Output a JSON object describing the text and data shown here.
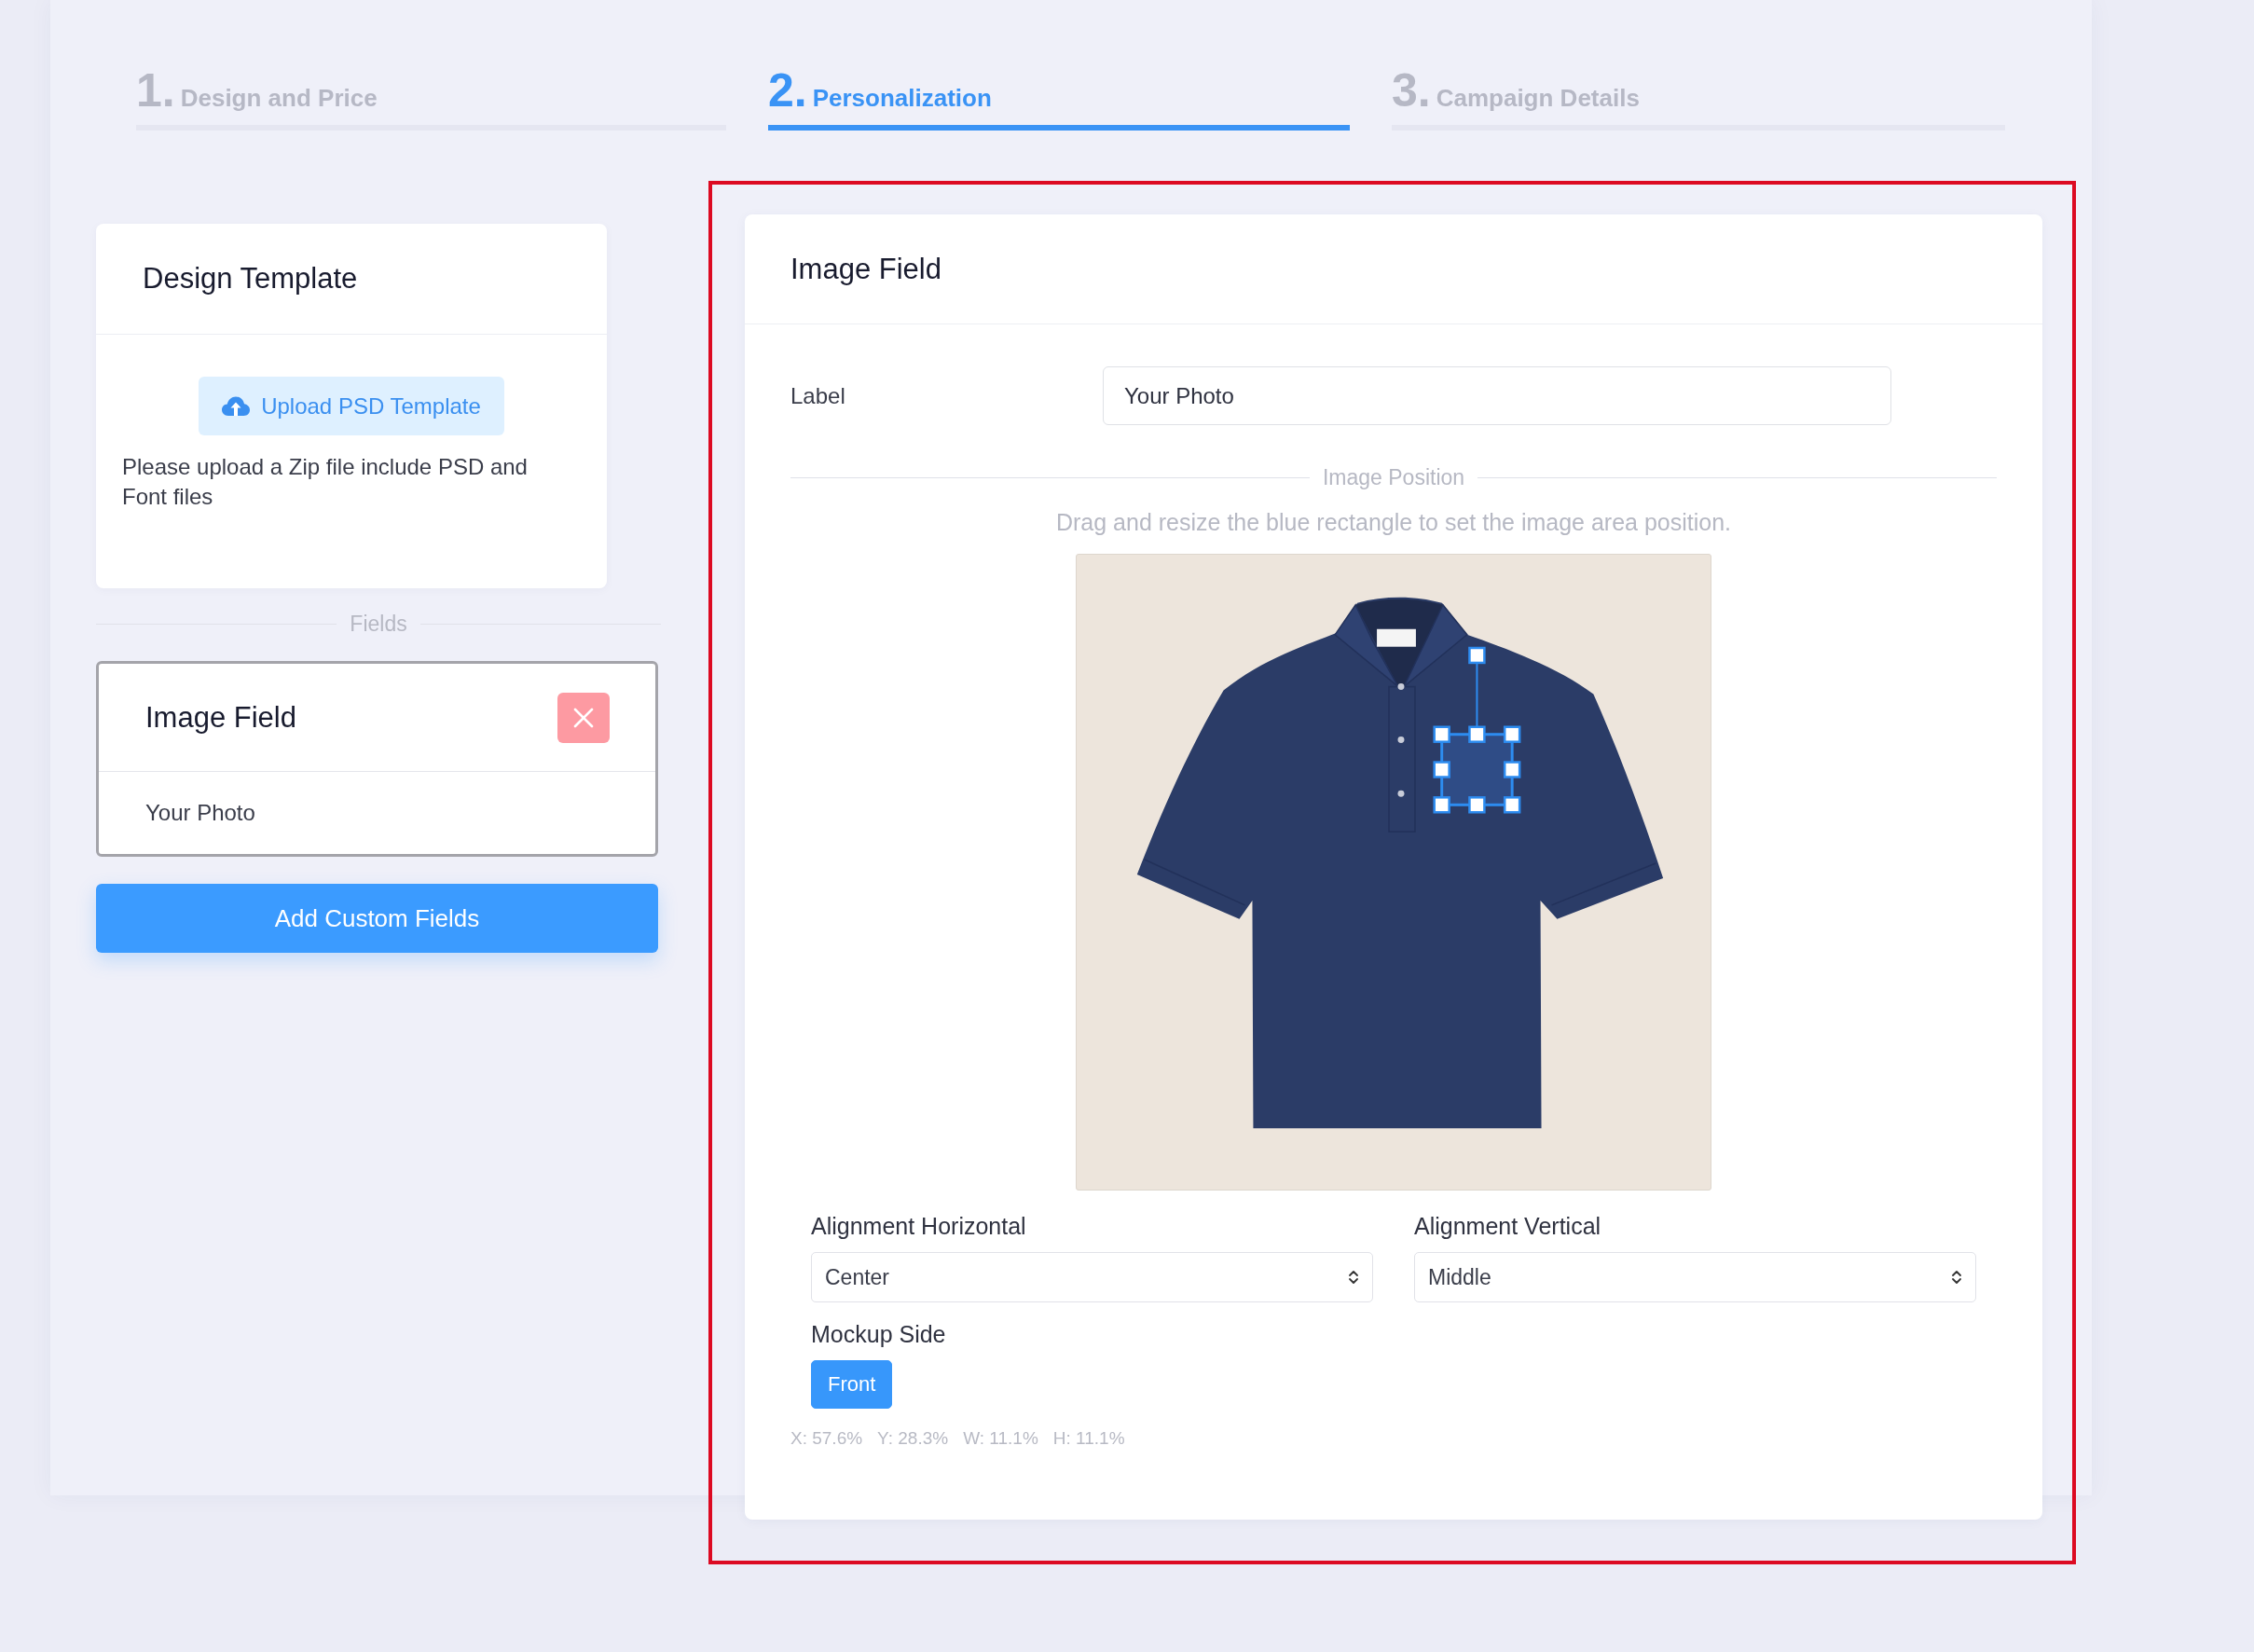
{
  "steps": [
    {
      "number": "1.",
      "label": "Design and Price",
      "selected": false
    },
    {
      "number": "2.",
      "label": "Personalization",
      "selected": true
    },
    {
      "number": "3.",
      "label": "Campaign Details",
      "selected": false
    }
  ],
  "design_template": {
    "title": "Design Template",
    "upload_button": "Upload PSD Template",
    "note": "Please upload a Zip file include PSD and Font files"
  },
  "fields": {
    "divider": "Fields",
    "cards": [
      {
        "title": "Image Field",
        "value": "Your Photo",
        "selected": true
      }
    ],
    "add_button": "Add Custom Fields"
  },
  "editor": {
    "title": "Image Field",
    "label_field": {
      "label": "Label",
      "value": "Your Photo"
    },
    "position_divider": "Image Position",
    "hint": "Drag and resize the blue rectangle to set the image area position.",
    "alignment": [
      {
        "label": "Alignment Horizontal",
        "value": "Center"
      },
      {
        "label": "Alignment Vertical",
        "value": "Middle"
      }
    ],
    "mockup_side": {
      "label": "Mockup Side",
      "options": [
        {
          "label": "Front",
          "selected": true
        }
      ]
    },
    "coordinates": [
      "X: 57.6%",
      "Y: 28.3%",
      "W: 11.1%",
      "H: 11.1%"
    ]
  }
}
